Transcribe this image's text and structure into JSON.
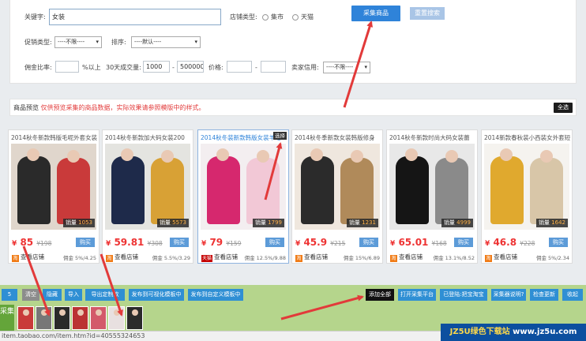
{
  "form": {
    "keyword_label": "关键字:",
    "keyword_value": "女装",
    "store_type_label": "店铺类型:",
    "store_type_options": [
      "集市",
      "天猫"
    ],
    "collect_button": "采集商品",
    "reset_button": "重置搜索",
    "promo_label": "促销类型:",
    "promo_value": "----不限----",
    "sort_label": "排序:",
    "sort_value": "----默认----",
    "commission_label": "佣金比率:",
    "commission_suffix": "%以上",
    "volume_label": "30天成交量:",
    "volume_min": "1000",
    "volume_sep": "-",
    "volume_max": "500000",
    "price_label": "价格:",
    "price_sep": "-",
    "credit_label": "卖家信用:",
    "credit_value": "----不限----"
  },
  "preview": {
    "title": "商品预览",
    "hint": "仅供预览采集的商品数据，实际效果请参照模版中的样式。",
    "select_all": "全选"
  },
  "products": [
    {
      "title": "2014秋冬新款韩版毛呢外套女装",
      "sales_label": "销量",
      "sales": "1053",
      "currency": "¥",
      "price": "85",
      "old_price": "¥198",
      "buy": "购买",
      "shop": "查看店铺",
      "shop_badge": "淘",
      "commission": "佣金 5%/4.25",
      "colors": [
        "#2a2a2a",
        "#c93a3a",
        "#e0d6cc"
      ],
      "selected": false
    },
    {
      "title": "2014秋冬新款加大码女装200",
      "sales_label": "销量",
      "sales": "5573",
      "currency": "¥",
      "price": "59.81",
      "old_price": "¥308",
      "buy": "购买",
      "shop": "查看店铺",
      "shop_badge": "淘",
      "commission": "佣金 5.5%/3.29",
      "colors": [
        "#1e2a4a",
        "#d8a135",
        "#e4e4e0"
      ],
      "selected": false
    },
    {
      "title": "2014秋冬装新款韩版女装羊毛",
      "sales_label": "销量",
      "sales": "1799",
      "currency": "¥",
      "price": "79",
      "old_price": "¥159",
      "buy": "购买",
      "shop": "查看店铺",
      "shop_badge": "天猫",
      "commission": "佣金 12.5%/9.88",
      "colors": [
        "#d6286e",
        "#f2c8d6",
        "#f3eef0"
      ],
      "selected": true,
      "choose": "选择"
    },
    {
      "title": "2014秋冬季新款女装韩版修身",
      "sales_label": "销量",
      "sales": "1231",
      "currency": "¥",
      "price": "45.9",
      "old_price": "¥215",
      "buy": "购买",
      "shop": "查看店铺",
      "shop_badge": "淘",
      "commission": "佣金 15%/6.89",
      "colors": [
        "#2b2b2b",
        "#b08a5a",
        "#efe7de"
      ],
      "selected": false
    },
    {
      "title": "2014秋冬新款时尚大码女装蕾",
      "sales_label": "销量",
      "sales": "4999",
      "currency": "¥",
      "price": "65.01",
      "old_price": "¥168",
      "buy": "购买",
      "shop": "查看店铺",
      "shop_badge": "淘",
      "commission": "佣金 13.1%/8.52",
      "colors": [
        "#151515",
        "#8a8a8a",
        "#e8e8e8"
      ],
      "selected": false
    },
    {
      "title": "2014新款春秋装小西装女外套短",
      "sales_label": "销量",
      "sales": "1642",
      "currency": "¥",
      "price": "46.8",
      "old_price": "¥228",
      "buy": "购买",
      "shop": "查看店铺",
      "shop_badge": "淘",
      "commission": "佣金 5%/2.34",
      "colors": [
        "#e0a92e",
        "#d8c6a8",
        "#f5f3ef"
      ],
      "selected": false
    }
  ],
  "toolbar": {
    "count": "5",
    "clear": "清空",
    "hide": "隐藏",
    "import": "导入",
    "export": "导出定制款",
    "publish_template": "发布到可视化模板中",
    "publish_custom": "发布到自定义模板中",
    "add_all": "添加全部",
    "open_platform": "打开采集平台",
    "login": "已登陆:把宝淘宝",
    "help": "采集器说明?",
    "check_update": "检查更新",
    "collapse": "收起"
  },
  "collect_label": "采集",
  "thumb_colors": [
    "#c93a3a",
    "#777",
    "#2a2a2a",
    "#b33",
    "#d35a6a",
    "#e8e0e0",
    "#2b2b2b"
  ],
  "status_url": "item.taobao.com/item.htm?id=40555324653",
  "watermark": {
    "brand": "JZ5U绿色下载站",
    "url": "www.jz5u.com"
  },
  "colors": {
    "accent": "#2f83d9",
    "price": "#e33333",
    "arrow": "#e23a3a",
    "toolbar_bg": "#b5d58c"
  }
}
